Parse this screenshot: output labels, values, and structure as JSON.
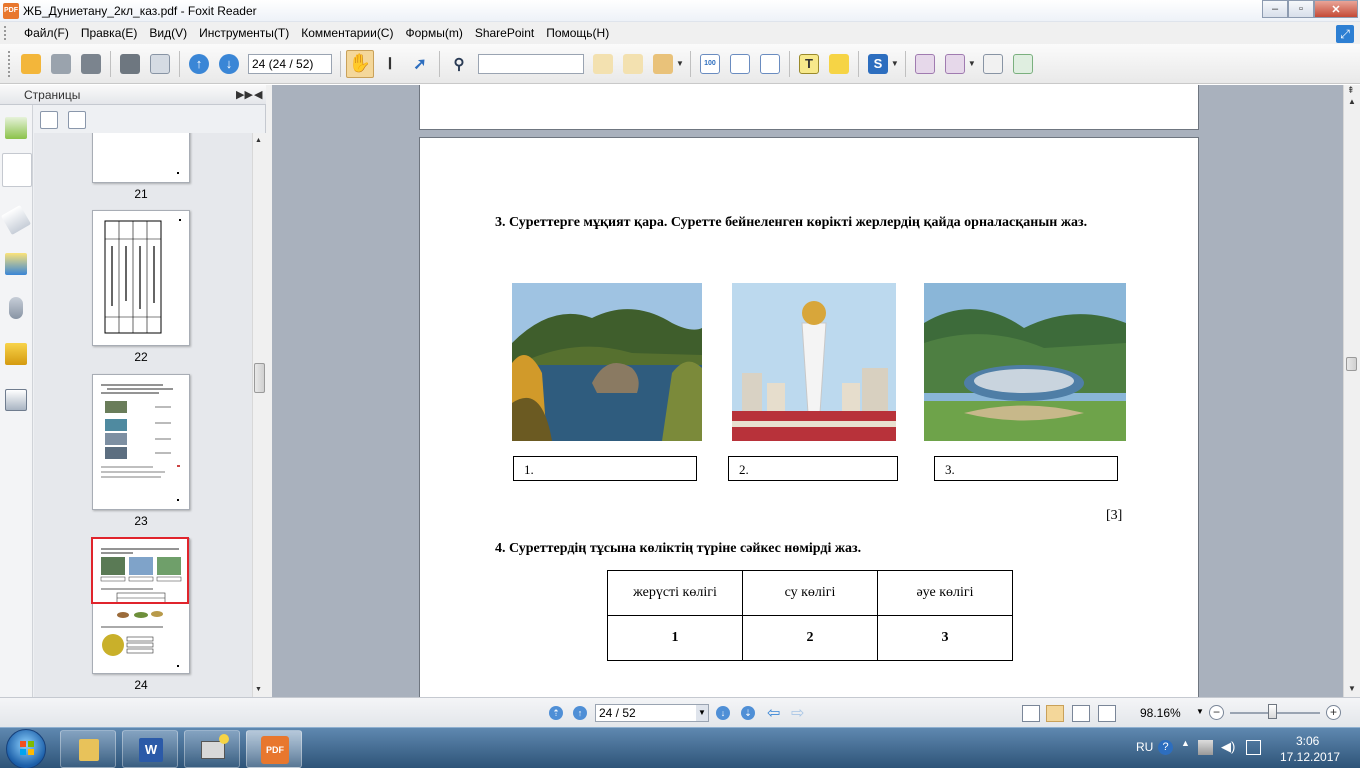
{
  "window": {
    "title": "ЖБ_Дуниетану_2кл_каз.pdf - Foxit Reader",
    "app_icon_text": "PDF",
    "minimize": "–",
    "maximize": "▫",
    "close": "✕"
  },
  "menu": {
    "items": [
      "Файл(F)",
      "Правка(E)",
      "Вид(V)",
      "Инструменты(T)",
      "Комментарии(C)",
      "Формы(m)",
      "SharePoint",
      "Помощь(H)"
    ]
  },
  "toolbar": {
    "page_field": "24 (24 / 52)",
    "find_placeholder": ""
  },
  "left_panel": {
    "title": "Страницы",
    "thumbnails": [
      {
        "label": "21"
      },
      {
        "label": "22"
      },
      {
        "label": "23"
      },
      {
        "label": "24",
        "selected": true
      }
    ]
  },
  "page": {
    "question3": "3. Суреттерге мұқият қара. Суретте бейнеленген көрікті жерлердің қайда орналасқанын жаз.",
    "answer_boxes": [
      "1.",
      "2.",
      "3."
    ],
    "score": "[3]",
    "question4": "4. Суреттердің  тұсына көліктің түріне сәйкес нөмірді  жаз.",
    "table": {
      "headers": [
        "жерүсті көлігі",
        "су көлігі",
        "әуе көлігі"
      ],
      "numbers": [
        "1",
        "2",
        "3"
      ]
    }
  },
  "statusbar": {
    "page_select": "24 / 52",
    "zoom": "98.16%"
  },
  "taskbar": {
    "language": "RU",
    "time": "3:06",
    "date": "17.12.2017"
  },
  "colors": {
    "selected_thumb": "#e0242c",
    "doc_background": "#a9b1bd",
    "taskbar": "#2e5478"
  }
}
